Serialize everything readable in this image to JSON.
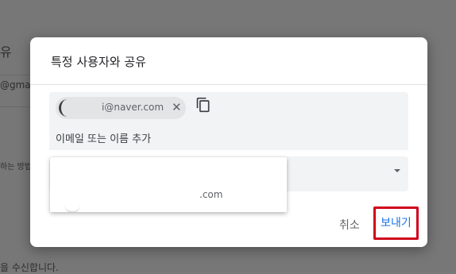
{
  "background": {
    "fragment_1": "유",
    "fragment_2": "@gmai",
    "fragment_3": "하는 방법",
    "fragment_4": "을 수신합니다."
  },
  "dialog": {
    "title": "특정 사용자와 공유",
    "recipients": {
      "chips": [
        {
          "email": "i@naver.com",
          "remove_icon": "close-icon"
        }
      ],
      "copy_icon": "copy-icon",
      "input_placeholder": "이메일 또는 이름 추가"
    },
    "suggestion": {
      "email": ".com"
    },
    "buttons": {
      "cancel": "취소",
      "send": "보내기"
    }
  },
  "colors": {
    "accent": "#1a73e8",
    "highlight": "#d0021b"
  }
}
